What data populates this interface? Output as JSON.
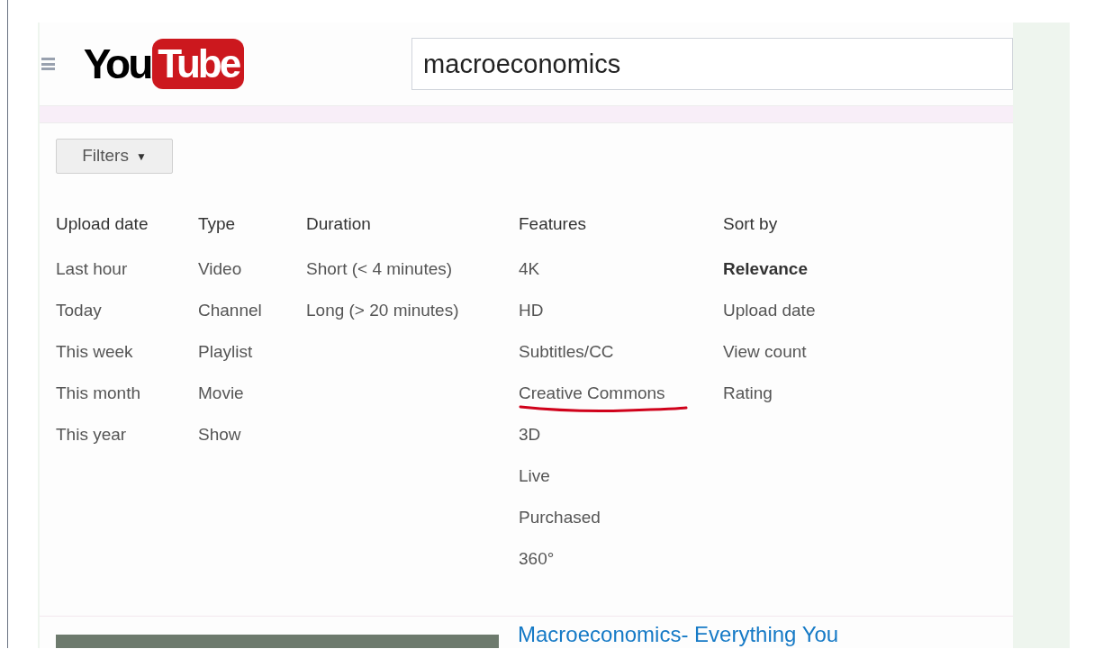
{
  "header": {
    "logo": {
      "word": "You",
      "badge": "Tube"
    },
    "search": {
      "value": "macroeconomics"
    }
  },
  "filters_button": {
    "label": "Filters",
    "caret": "▼"
  },
  "filter_columns": [
    {
      "title": "Upload date",
      "items": [
        {
          "label": "Last hour"
        },
        {
          "label": "Today"
        },
        {
          "label": "This week"
        },
        {
          "label": "This month"
        },
        {
          "label": "This year"
        }
      ]
    },
    {
      "title": "Type",
      "items": [
        {
          "label": "Video"
        },
        {
          "label": "Channel"
        },
        {
          "label": "Playlist"
        },
        {
          "label": "Movie"
        },
        {
          "label": "Show"
        }
      ]
    },
    {
      "title": "Duration",
      "items": [
        {
          "label": "Short (< 4 minutes)"
        },
        {
          "label": "Long (> 20 minutes)"
        }
      ]
    },
    {
      "title": "Features",
      "items": [
        {
          "label": "4K",
          "underlined": false
        },
        {
          "label": "HD",
          "underlined": false
        },
        {
          "label": "Subtitles/CC",
          "underlined": false
        },
        {
          "label": "Creative Commons",
          "underlined": true
        },
        {
          "label": "3D",
          "underlined": false
        },
        {
          "label": "Live",
          "underlined": false
        },
        {
          "label": "Purchased",
          "underlined": false
        },
        {
          "label": "360°",
          "underlined": false
        }
      ]
    },
    {
      "title": "Sort by",
      "items": [
        {
          "label": "Relevance",
          "selected": true
        },
        {
          "label": "Upload date",
          "selected": false
        },
        {
          "label": "View count",
          "selected": false
        },
        {
          "label": "Rating",
          "selected": false
        }
      ]
    }
  ],
  "result": {
    "title": "Macroeconomics- Everything You"
  }
}
